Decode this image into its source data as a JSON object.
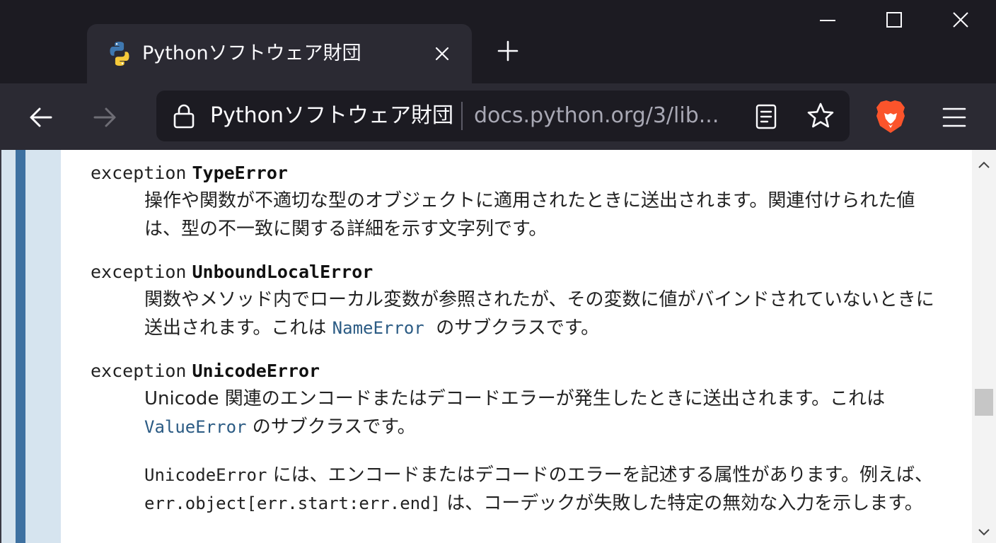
{
  "window": {
    "minimize_icon": "minimize-icon",
    "maximize_icon": "maximize-icon",
    "close_icon": "close-icon"
  },
  "tab": {
    "title": "Pythonソフトウェア財団",
    "favicon": "python-logo-icon",
    "close_icon": "close-icon",
    "new_tab_icon": "plus-icon"
  },
  "toolbar": {
    "back_icon": "arrow-left-icon",
    "forward_icon": "arrow-right-icon",
    "site_identity": "Pythonソフトウェア財団",
    "url": "docs.python.org/3/lib...",
    "reader_icon": "reader-view-icon",
    "bookmark_icon": "star-icon",
    "extension_icon": "brave-lion-icon",
    "menu_icon": "hamburger-menu-icon",
    "colors": {
      "brave": "#fb542b",
      "sidebar_bar": "#3e71a1",
      "link": "#2b5b84"
    }
  },
  "content": {
    "entries": [
      {
        "keyword": "exception",
        "name": "TypeError",
        "description": "操作や関数が不適切な型のオブジェクトに適用されたときに送出されます。関連付けられた値は、型の不一致に関する詳細を示す文字列です。"
      },
      {
        "keyword": "exception",
        "name": "UnboundLocalError",
        "desc_before": "関数やメソッド内でローカル変数が参照されたが、その変数に値がバインドされていないときに送出されます。これは",
        "desc_link": "NameError",
        "desc_after": "のサブクラスです。"
      },
      {
        "keyword": "exception",
        "name": "UnicodeError",
        "desc_before": "Unicode 関連のエンコードまたはデコードエラーが発生したときに送出されます。これは",
        "desc_link": "ValueError",
        "desc_after": "のサブクラスです。",
        "para2_code1": "UnicodeError",
        "para2_text1": "には、エンコードまたはデコードのエラーを記述する属性があります。例えば、",
        "para2_code2": "err.object[err.start:err.end]",
        "para2_text2": "は、コーデックが失敗した特定の無効な入力を示します。"
      }
    ]
  }
}
